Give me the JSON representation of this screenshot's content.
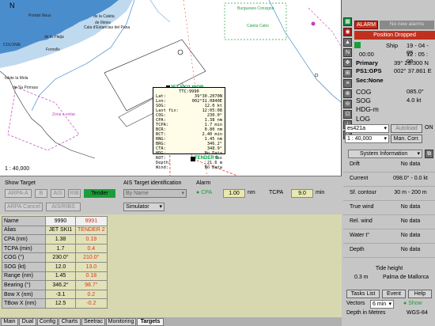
{
  "chart": {
    "scale": "1 : 40,000",
    "labels": {
      "portals_nous": "Portals Nous",
      "la_caleta": "de la Caleta",
      "de_illetes": "de Illetes",
      "cala_estancias": "Cala d'Estancias del Pana",
      "colonie": "COLONIE",
      "de_la_platja": "de la Platja",
      "islote_la_mola": "Islote la Mola",
      "de_sa_porrasa": "de Sa Porrasa",
      "fornells": "Fornells",
      "zona_a_evitar": "Zona a evitar",
      "burgueses": "Burgueses Consigna",
      "cabo_de_caleta": "Caleta Cabo"
    },
    "jet_label": "JET SKI1 WOR",
    "tender_label": "TENDER 2",
    "track_info": {
      "ttc": "TTC:9990",
      "rows": [
        {
          "k": "Lat:",
          "v": "39°30.2070N"
        },
        {
          "k": "Lon:",
          "v": "002°31.0840E"
        },
        {
          "k": "SOG:",
          "v": "12.0 kt"
        },
        {
          "k": "Last fix:",
          "v": "12:05:08"
        },
        {
          "k": "COG:",
          "v": "230.0°"
        },
        {
          "k": "CPA:",
          "v": "1.38 nm"
        },
        {
          "k": "TCPA:",
          "v": "1.7 min"
        },
        {
          "k": "BCR:",
          "v": "0.80 nm"
        },
        {
          "k": "BCT:",
          "v": "2.40 min"
        },
        {
          "k": "RNG:",
          "v": "1.45 nm"
        },
        {
          "k": "BRG:",
          "v": "346.2°"
        },
        {
          "k": "CTA:",
          "v": "348.9°"
        },
        {
          "k": "HDG:",
          "v": "No Data"
        },
        {
          "k": "ROT:",
          "v": "Yes"
        },
        {
          "k": "Depth:",
          "v": "21.6 m"
        },
        {
          "k": "Wind:",
          "v": "No Data"
        }
      ]
    }
  },
  "right": {
    "alarm_label": "ALARM",
    "no_alarms": "No new alarms",
    "position_dropped": "Position Dropped",
    "ship_label": "Ship",
    "date": "19 - 04 - 05",
    "time_left": "00:00",
    "time_right": "12 : 05 : 08",
    "primary_label": "Primary",
    "lat": "39° 29.300 N",
    "sensor_label": "PS1:GPS",
    "lon": "002° 37.861 E",
    "sec_label": "Sec:None",
    "cog_label": "COG",
    "cog_value": "085.0°",
    "sog_label": "SOG",
    "sog_value": "4.0 kt",
    "hdg_label": "HDG-m",
    "log_label": "LOG",
    "chart_sel": "es421a",
    "autoload_label": "Autoload",
    "on_label": "ON",
    "scale_sel": "1 : 40,000",
    "man_corr": "Man. Corr.",
    "sysinfo_sel": "System Information",
    "sysinfo_rows": [
      {
        "label": "Drift",
        "value": "No data"
      },
      {
        "label": "Current",
        "value": "098.0° - 0.0 kt"
      },
      {
        "label": "Sf. contour",
        "value": "30 m - 200 m"
      },
      {
        "label": "True wind",
        "value": "No data"
      },
      {
        "label": "Rel. wind",
        "value": "No data"
      },
      {
        "label": "Water t°",
        "value": "No data"
      },
      {
        "label": "Depth",
        "value": "No data"
      }
    ],
    "tide_title": "Tide height",
    "tide_value": "0.3 m",
    "tide_place": "Palma de Mallorca",
    "tasks_list": "Tasks List",
    "event": "Event",
    "help": "Help",
    "vectors_label": "Vectors",
    "vectors_sel": "6 min",
    "show_label": "Show",
    "depth_units": "Depth in Metres",
    "datum": "WGS-84"
  },
  "controls": {
    "show_target": "Show Target",
    "arpa_a": "ARPA-A",
    "b": "B",
    "ais": "AIS",
    "rib": "RIB",
    "tender": "Tender",
    "arpa_cancel": "ARPA Cancel",
    "ais_ribs": "AIS/RIBS",
    "ais_ident": "AIS Target identification",
    "by_name": "By Name",
    "simulator": "Simulator",
    "alarm_title": "Alarm",
    "cpa": "CPA",
    "cpa_value": "1.00",
    "nm": "nm",
    "tcpa": "TCPA",
    "tcpa_value": "9.0",
    "min": "min"
  },
  "targets": {
    "header": {
      "label": "Name",
      "t1": "9990",
      "t2": "9991"
    },
    "rows": [
      {
        "label": "Alias",
        "t1": "JET SKI1",
        "t2": "TENDER 2"
      },
      {
        "label": "CPA (nm)",
        "t1": "1.38",
        "t2": "0.19"
      },
      {
        "label": "TCPA (min)",
        "t1": "1.7",
        "t2": "0.4"
      },
      {
        "label": "COG (°)",
        "t1": "230.0°",
        "t2": "210.0°"
      },
      {
        "label": "SOG (kt)",
        "t1": "12.0",
        "t2": "13.0"
      },
      {
        "label": "Range (nm)",
        "t1": "1.45",
        "t2": "0.18"
      },
      {
        "label": "Bearing (°)",
        "t1": "346.2°",
        "t2": "98.7°"
      },
      {
        "label": "Bow X (nm)",
        "t1": "-3.1",
        "t2": "0.2"
      },
      {
        "label": "TBow X (nm)",
        "t1": "12.5",
        "t2": "-0.2"
      }
    ]
  },
  "tabs": [
    "Main",
    "Dual",
    "Config",
    "Charts",
    "Seetrac",
    "Monitoring",
    "Targets"
  ],
  "colors": {
    "alarm": "#c0301e",
    "accent": "#1d9c3a",
    "land": "#1e6fbf"
  }
}
